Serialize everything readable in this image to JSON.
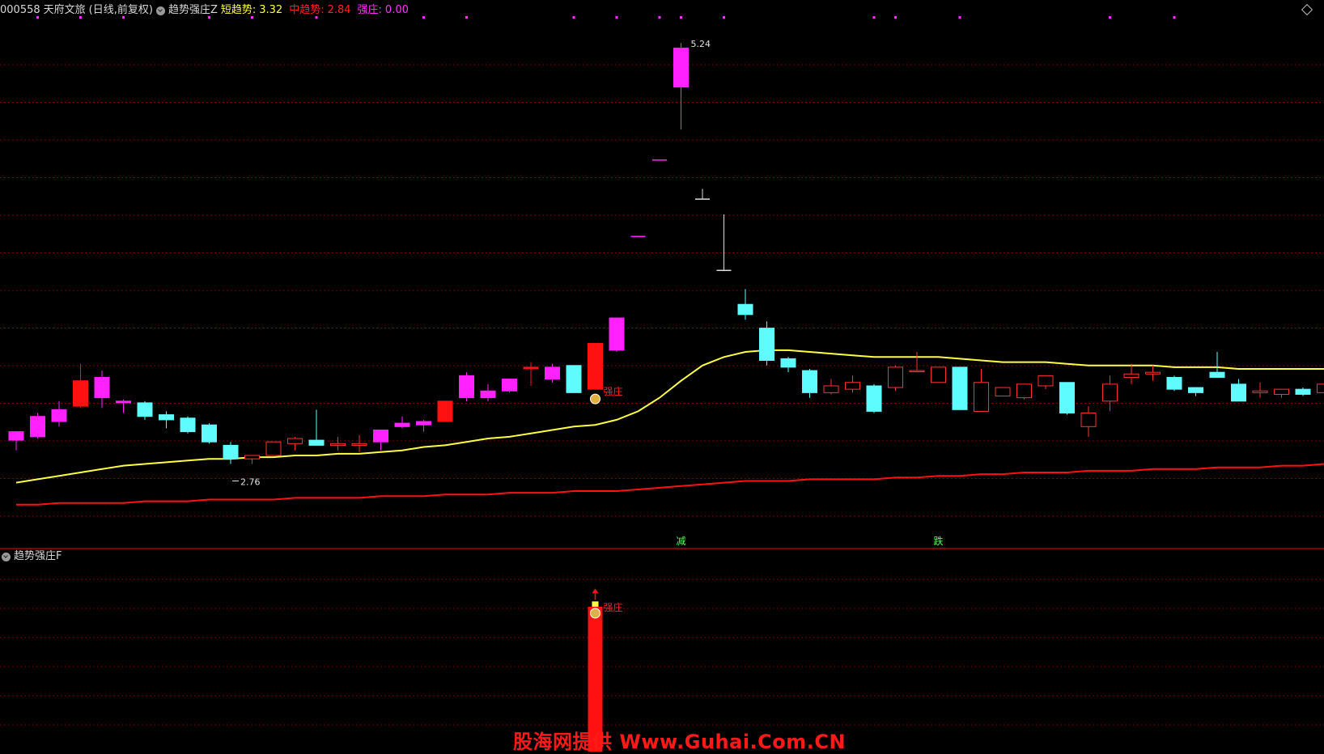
{
  "header": {
    "stock_code": "000558",
    "stock_name": "天府文旅",
    "period": "(日线,前复权)",
    "indicator_main": "趋势强庄Z",
    "short_label": "短趋势:",
    "short_value": "3.32",
    "mid_label": "中趋势:",
    "mid_value": "2.84",
    "strong_label": "强庄:",
    "strong_value": "0.00"
  },
  "sub_header": {
    "indicator_sub": "趋势强庄F"
  },
  "watermark": "股海网提供 Www.Guhai.Com.CN",
  "colors": {
    "background": "#000000",
    "grid": "#7a0000",
    "separator": "#b00000",
    "up_outline": "#ff3333",
    "up_fill_magenta": "#ff22ff",
    "up_fill_red": "#ff1111",
    "down_fill_cyan": "#5ffcff",
    "short_trend_line": "#ffff44",
    "mid_trend_line": "#ff1111",
    "signal_text": "#55ff55",
    "strong_label": "#ff2222"
  },
  "chart_data": {
    "type": "candlestick",
    "price_range": [
      2.3,
      5.35
    ],
    "sub_range": [
      0,
      1.0
    ],
    "candles": [
      {
        "o": 2.9,
        "h": 2.95,
        "l": 2.84,
        "c": 2.95,
        "style": "magenta"
      },
      {
        "o": 2.92,
        "h": 3.06,
        "l": 2.91,
        "c": 3.04,
        "style": "magenta"
      },
      {
        "o": 3.01,
        "h": 3.13,
        "l": 2.98,
        "c": 3.08,
        "style": "magenta"
      },
      {
        "o": 3.1,
        "h": 3.35,
        "l": 3.09,
        "c": 3.25,
        "style": "red"
      },
      {
        "o": 3.15,
        "h": 3.31,
        "l": 3.09,
        "c": 3.27,
        "style": "magenta"
      },
      {
        "o": 3.12,
        "h": 3.14,
        "l": 3.06,
        "c": 3.13,
        "style": "magenta"
      },
      {
        "o": 3.12,
        "h": 3.13,
        "l": 3.02,
        "c": 3.04,
        "style": "cyan"
      },
      {
        "o": 3.05,
        "h": 3.07,
        "l": 2.97,
        "c": 3.02,
        "style": "cyan"
      },
      {
        "o": 3.03,
        "h": 3.04,
        "l": 2.94,
        "c": 2.95,
        "style": "cyan"
      },
      {
        "o": 2.99,
        "h": 3.0,
        "l": 2.88,
        "c": 2.89,
        "style": "cyan"
      },
      {
        "o": 2.87,
        "h": 2.89,
        "l": 2.76,
        "c": 2.79,
        "style": "cyan"
      },
      {
        "o": 2.79,
        "h": 2.81,
        "l": 2.76,
        "c": 2.81,
        "style": "outline"
      },
      {
        "o": 2.81,
        "h": 2.89,
        "l": 2.81,
        "c": 2.89,
        "style": "outline"
      },
      {
        "o": 2.88,
        "h": 2.92,
        "l": 2.84,
        "c": 2.91,
        "style": "outline"
      },
      {
        "o": 2.9,
        "h": 3.08,
        "l": 2.88,
        "c": 2.87,
        "style": "cyan"
      },
      {
        "o": 2.87,
        "h": 2.92,
        "l": 2.84,
        "c": 2.88,
        "style": "outline"
      },
      {
        "o": 2.87,
        "h": 2.93,
        "l": 2.83,
        "c": 2.88,
        "style": "outline"
      },
      {
        "o": 2.89,
        "h": 2.96,
        "l": 2.84,
        "c": 2.96,
        "style": "magenta"
      },
      {
        "o": 2.98,
        "h": 3.04,
        "l": 2.97,
        "c": 3.0,
        "style": "magenta"
      },
      {
        "o": 2.99,
        "h": 3.02,
        "l": 2.95,
        "c": 3.01,
        "style": "magenta"
      },
      {
        "o": 3.01,
        "h": 3.13,
        "l": 3.01,
        "c": 3.13,
        "style": "red"
      },
      {
        "o": 3.15,
        "h": 3.3,
        "l": 3.13,
        "c": 3.28,
        "style": "magenta"
      },
      {
        "o": 3.15,
        "h": 3.23,
        "l": 3.13,
        "c": 3.19,
        "style": "magenta"
      },
      {
        "o": 3.19,
        "h": 3.26,
        "l": 3.18,
        "c": 3.26,
        "style": "magenta"
      },
      {
        "o": 3.32,
        "h": 3.36,
        "l": 3.22,
        "c": 3.33,
        "style": "red"
      },
      {
        "o": 3.26,
        "h": 3.35,
        "l": 3.24,
        "c": 3.33,
        "style": "magenta"
      },
      {
        "o": 3.34,
        "h": 3.34,
        "l": 3.18,
        "c": 3.18,
        "style": "cyan"
      },
      {
        "o": 3.2,
        "h": 3.47,
        "l": 3.2,
        "c": 3.47,
        "style": "red"
      },
      {
        "o": 3.43,
        "h": 3.62,
        "l": 3.42,
        "c": 3.62,
        "style": "magenta"
      },
      {
        "o": 4.1,
        "h": 4.1,
        "l": 4.1,
        "c": 4.1,
        "style": "dash"
      },
      {
        "o": 4.55,
        "h": 4.55,
        "l": 4.55,
        "c": 4.55,
        "style": "dash"
      },
      {
        "o": 4.98,
        "h": 5.24,
        "l": 4.73,
        "c": 5.21,
        "style": "magenta"
      },
      {
        "o": 4.32,
        "h": 4.38,
        "l": 4.32,
        "c": 4.32,
        "style": "dash"
      },
      {
        "o": 3.9,
        "h": 4.23,
        "l": 3.9,
        "c": 3.9,
        "style": "dash"
      },
      {
        "o": 3.7,
        "h": 3.79,
        "l": 3.61,
        "c": 3.64,
        "style": "cyan"
      },
      {
        "o": 3.56,
        "h": 3.6,
        "l": 3.34,
        "c": 3.37,
        "style": "cyan"
      },
      {
        "o": 3.38,
        "h": 3.39,
        "l": 3.3,
        "c": 3.33,
        "style": "cyan"
      },
      {
        "o": 3.31,
        "h": 3.32,
        "l": 3.15,
        "c": 3.18,
        "style": "cyan"
      },
      {
        "o": 3.18,
        "h": 3.26,
        "l": 3.17,
        "c": 3.22,
        "style": "outline"
      },
      {
        "o": 3.2,
        "h": 3.28,
        "l": 3.18,
        "c": 3.24,
        "style": "outline"
      },
      {
        "o": 3.22,
        "h": 3.23,
        "l": 3.06,
        "c": 3.07,
        "style": "cyan"
      },
      {
        "o": 3.21,
        "h": 3.34,
        "l": 3.19,
        "c": 3.33,
        "style": "outline"
      },
      {
        "o": 3.31,
        "h": 3.42,
        "l": 3.3,
        "c": 3.31,
        "style": "outline"
      },
      {
        "o": 3.33,
        "h": 3.33,
        "l": 3.24,
        "c": 3.24,
        "style": "outline"
      },
      {
        "o": 3.33,
        "h": 3.33,
        "l": 3.08,
        "c": 3.08,
        "style": "cyan"
      },
      {
        "o": 3.07,
        "h": 3.32,
        "l": 3.07,
        "c": 3.24,
        "style": "outline"
      },
      {
        "o": 3.16,
        "h": 3.21,
        "l": 3.16,
        "c": 3.21,
        "style": "outline"
      },
      {
        "o": 3.15,
        "h": 3.23,
        "l": 3.14,
        "c": 3.23,
        "style": "outline"
      },
      {
        "o": 3.22,
        "h": 3.28,
        "l": 3.2,
        "c": 3.28,
        "style": "outline"
      },
      {
        "o": 3.24,
        "h": 3.24,
        "l": 3.05,
        "c": 3.06,
        "style": "cyan"
      },
      {
        "o": 2.98,
        "h": 3.1,
        "l": 2.92,
        "c": 3.06,
        "style": "outline"
      },
      {
        "o": 3.13,
        "h": 3.28,
        "l": 3.07,
        "c": 3.23,
        "style": "outline"
      },
      {
        "o": 3.27,
        "h": 3.35,
        "l": 3.23,
        "c": 3.29,
        "style": "outline"
      },
      {
        "o": 3.29,
        "h": 3.34,
        "l": 3.25,
        "c": 3.3,
        "style": "outline"
      },
      {
        "o": 3.27,
        "h": 3.28,
        "l": 3.19,
        "c": 3.2,
        "style": "cyan"
      },
      {
        "o": 3.21,
        "h": 3.21,
        "l": 3.16,
        "c": 3.18,
        "style": "cyan"
      },
      {
        "o": 3.3,
        "h": 3.42,
        "l": 3.27,
        "c": 3.27,
        "style": "cyan"
      },
      {
        "o": 3.23,
        "h": 3.26,
        "l": 3.13,
        "c": 3.13,
        "style": "cyan"
      },
      {
        "o": 3.18,
        "h": 3.24,
        "l": 3.15,
        "c": 3.19,
        "style": "outline"
      },
      {
        "o": 3.17,
        "h": 3.2,
        "l": 3.15,
        "c": 3.2,
        "style": "outline"
      },
      {
        "o": 3.2,
        "h": 3.21,
        "l": 3.16,
        "c": 3.17,
        "style": "cyan"
      },
      {
        "o": 3.18,
        "h": 3.25,
        "l": 3.15,
        "c": 3.23,
        "style": "outline"
      },
      {
        "o": 3.22,
        "h": 3.27,
        "l": 3.18,
        "c": 3.27,
        "style": "magenta"
      }
    ],
    "series": [
      {
        "name": "短趋势",
        "values": [
          2.65,
          2.67,
          2.69,
          2.71,
          2.73,
          2.75,
          2.76,
          2.77,
          2.78,
          2.79,
          2.79,
          2.8,
          2.8,
          2.81,
          2.81,
          2.82,
          2.82,
          2.83,
          2.84,
          2.86,
          2.87,
          2.89,
          2.91,
          2.92,
          2.94,
          2.96,
          2.98,
          2.99,
          3.02,
          3.07,
          3.15,
          3.25,
          3.34,
          3.39,
          3.42,
          3.43,
          3.43,
          3.42,
          3.41,
          3.4,
          3.39,
          3.39,
          3.39,
          3.39,
          3.38,
          3.37,
          3.36,
          3.36,
          3.36,
          3.35,
          3.34,
          3.34,
          3.34,
          3.34,
          3.33,
          3.33,
          3.33,
          3.32,
          3.32,
          3.32,
          3.32,
          3.32,
          3.32
        ]
      },
      {
        "name": "中趋势",
        "values": [
          2.52,
          2.52,
          2.53,
          2.53,
          2.53,
          2.53,
          2.54,
          2.54,
          2.54,
          2.55,
          2.55,
          2.55,
          2.55,
          2.56,
          2.56,
          2.56,
          2.56,
          2.57,
          2.57,
          2.57,
          2.58,
          2.58,
          2.58,
          2.59,
          2.59,
          2.59,
          2.6,
          2.6,
          2.6,
          2.61,
          2.62,
          2.63,
          2.64,
          2.65,
          2.66,
          2.66,
          2.66,
          2.67,
          2.67,
          2.67,
          2.67,
          2.68,
          2.68,
          2.69,
          2.69,
          2.7,
          2.7,
          2.71,
          2.71,
          2.71,
          2.72,
          2.72,
          2.72,
          2.73,
          2.73,
          2.73,
          2.74,
          2.74,
          2.74,
          2.75,
          2.75,
          2.76,
          2.76
        ]
      }
    ],
    "annotations": {
      "high_label": "5.24",
      "high_index": 31,
      "low_label": "2.76",
      "low_index": 10,
      "strong_label": "强庄",
      "strong_index": 27,
      "signal_a": "减",
      "signal_a_index": 31,
      "signal_b": "跌",
      "signal_b_index": 43
    },
    "sub_bars": [
      {
        "index": 27,
        "red_value": 1.0,
        "yellow_value": 0.25
      }
    ],
    "top_markers": [
      1,
      3,
      5,
      9,
      11,
      14,
      19,
      21,
      26,
      28,
      30,
      31,
      33,
      40,
      41,
      44,
      51,
      54
    ]
  }
}
